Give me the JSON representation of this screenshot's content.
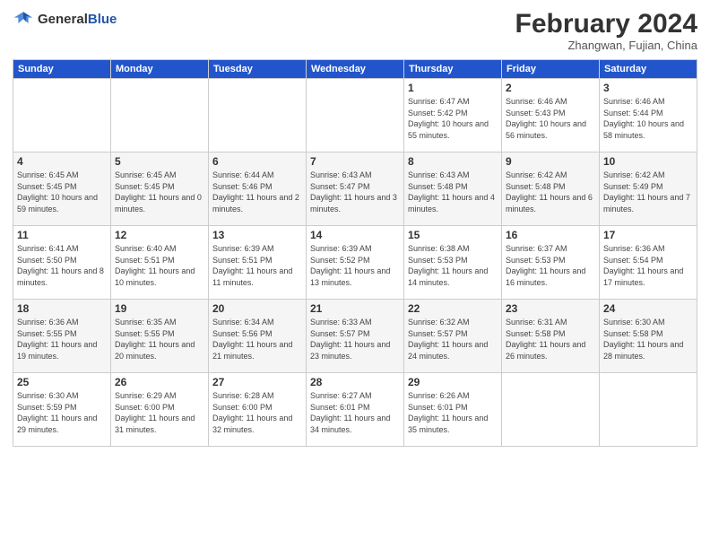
{
  "logo": {
    "general": "General",
    "blue": "Blue"
  },
  "header": {
    "month": "February 2024",
    "location": "Zhangwan, Fujian, China"
  },
  "weekdays": [
    "Sunday",
    "Monday",
    "Tuesday",
    "Wednesday",
    "Thursday",
    "Friday",
    "Saturday"
  ],
  "weeks": [
    [
      {
        "day": "",
        "info": ""
      },
      {
        "day": "",
        "info": ""
      },
      {
        "day": "",
        "info": ""
      },
      {
        "day": "",
        "info": ""
      },
      {
        "day": "1",
        "info": "Sunrise: 6:47 AM\nSunset: 5:42 PM\nDaylight: 10 hours and 55 minutes."
      },
      {
        "day": "2",
        "info": "Sunrise: 6:46 AM\nSunset: 5:43 PM\nDaylight: 10 hours and 56 minutes."
      },
      {
        "day": "3",
        "info": "Sunrise: 6:46 AM\nSunset: 5:44 PM\nDaylight: 10 hours and 58 minutes."
      }
    ],
    [
      {
        "day": "4",
        "info": "Sunrise: 6:45 AM\nSunset: 5:45 PM\nDaylight: 10 hours and 59 minutes."
      },
      {
        "day": "5",
        "info": "Sunrise: 6:45 AM\nSunset: 5:45 PM\nDaylight: 11 hours and 0 minutes."
      },
      {
        "day": "6",
        "info": "Sunrise: 6:44 AM\nSunset: 5:46 PM\nDaylight: 11 hours and 2 minutes."
      },
      {
        "day": "7",
        "info": "Sunrise: 6:43 AM\nSunset: 5:47 PM\nDaylight: 11 hours and 3 minutes."
      },
      {
        "day": "8",
        "info": "Sunrise: 6:43 AM\nSunset: 5:48 PM\nDaylight: 11 hours and 4 minutes."
      },
      {
        "day": "9",
        "info": "Sunrise: 6:42 AM\nSunset: 5:48 PM\nDaylight: 11 hours and 6 minutes."
      },
      {
        "day": "10",
        "info": "Sunrise: 6:42 AM\nSunset: 5:49 PM\nDaylight: 11 hours and 7 minutes."
      }
    ],
    [
      {
        "day": "11",
        "info": "Sunrise: 6:41 AM\nSunset: 5:50 PM\nDaylight: 11 hours and 8 minutes."
      },
      {
        "day": "12",
        "info": "Sunrise: 6:40 AM\nSunset: 5:51 PM\nDaylight: 11 hours and 10 minutes."
      },
      {
        "day": "13",
        "info": "Sunrise: 6:39 AM\nSunset: 5:51 PM\nDaylight: 11 hours and 11 minutes."
      },
      {
        "day": "14",
        "info": "Sunrise: 6:39 AM\nSunset: 5:52 PM\nDaylight: 11 hours and 13 minutes."
      },
      {
        "day": "15",
        "info": "Sunrise: 6:38 AM\nSunset: 5:53 PM\nDaylight: 11 hours and 14 minutes."
      },
      {
        "day": "16",
        "info": "Sunrise: 6:37 AM\nSunset: 5:53 PM\nDaylight: 11 hours and 16 minutes."
      },
      {
        "day": "17",
        "info": "Sunrise: 6:36 AM\nSunset: 5:54 PM\nDaylight: 11 hours and 17 minutes."
      }
    ],
    [
      {
        "day": "18",
        "info": "Sunrise: 6:36 AM\nSunset: 5:55 PM\nDaylight: 11 hours and 19 minutes."
      },
      {
        "day": "19",
        "info": "Sunrise: 6:35 AM\nSunset: 5:55 PM\nDaylight: 11 hours and 20 minutes."
      },
      {
        "day": "20",
        "info": "Sunrise: 6:34 AM\nSunset: 5:56 PM\nDaylight: 11 hours and 21 minutes."
      },
      {
        "day": "21",
        "info": "Sunrise: 6:33 AM\nSunset: 5:57 PM\nDaylight: 11 hours and 23 minutes."
      },
      {
        "day": "22",
        "info": "Sunrise: 6:32 AM\nSunset: 5:57 PM\nDaylight: 11 hours and 24 minutes."
      },
      {
        "day": "23",
        "info": "Sunrise: 6:31 AM\nSunset: 5:58 PM\nDaylight: 11 hours and 26 minutes."
      },
      {
        "day": "24",
        "info": "Sunrise: 6:30 AM\nSunset: 5:58 PM\nDaylight: 11 hours and 28 minutes."
      }
    ],
    [
      {
        "day": "25",
        "info": "Sunrise: 6:30 AM\nSunset: 5:59 PM\nDaylight: 11 hours and 29 minutes."
      },
      {
        "day": "26",
        "info": "Sunrise: 6:29 AM\nSunset: 6:00 PM\nDaylight: 11 hours and 31 minutes."
      },
      {
        "day": "27",
        "info": "Sunrise: 6:28 AM\nSunset: 6:00 PM\nDaylight: 11 hours and 32 minutes."
      },
      {
        "day": "28",
        "info": "Sunrise: 6:27 AM\nSunset: 6:01 PM\nDaylight: 11 hours and 34 minutes."
      },
      {
        "day": "29",
        "info": "Sunrise: 6:26 AM\nSunset: 6:01 PM\nDaylight: 11 hours and 35 minutes."
      },
      {
        "day": "",
        "info": ""
      },
      {
        "day": "",
        "info": ""
      }
    ]
  ]
}
